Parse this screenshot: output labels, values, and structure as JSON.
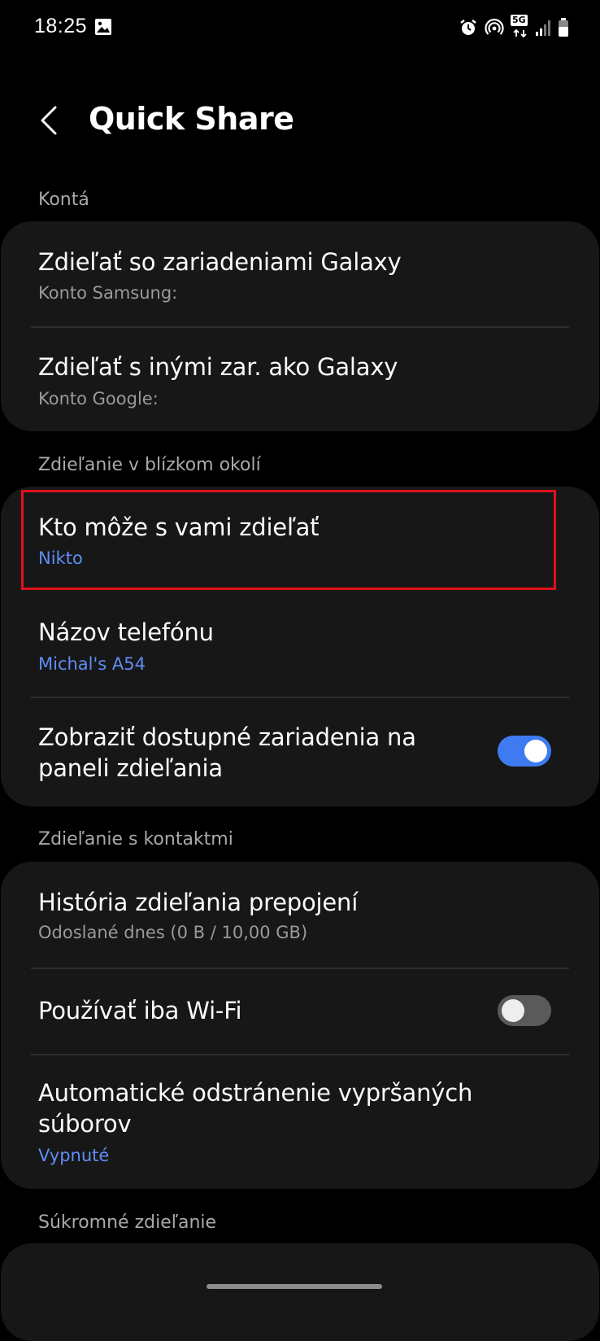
{
  "status_bar": {
    "time": "18:25",
    "left_icons": [
      "gallery-icon"
    ],
    "right_icons": [
      "alarm-icon",
      "hotspot-icon",
      "5g-icon",
      "signal-icon",
      "battery-icon"
    ],
    "network_label": "5G"
  },
  "header": {
    "back_icon": "chevron-left-icon",
    "title": "Quick Share"
  },
  "sections": {
    "accounts": {
      "label": "Kontá",
      "items": [
        {
          "title": "Zdieľať so zariadeniami Galaxy",
          "subtitle": "Konto Samsung:"
        },
        {
          "title": "Zdieľať s inými zar. ako Galaxy",
          "subtitle": "Konto Google:"
        }
      ]
    },
    "nearby": {
      "label": "Zdieľanie v blízkom okolí",
      "items": [
        {
          "title": "Kto môže s vami zdieľať",
          "subtitle": "Nikto"
        },
        {
          "title": "Názov telefónu",
          "subtitle": "Michal's A54"
        },
        {
          "title_line1": "Zobraziť dostupné zariadenia na",
          "title_line2": "paneli zdieľania",
          "toggle_on": true
        }
      ]
    },
    "contacts": {
      "label": "Zdieľanie s kontaktmi",
      "items": [
        {
          "title": "História zdieľania prepojení",
          "subtitle": "Odoslané dnes (0 B / 10,00 GB)"
        },
        {
          "title": "Používať iba Wi-Fi",
          "toggle_on": false
        },
        {
          "title_line1": "Automatické odstránenie vypršaných",
          "title_line2": "súborov",
          "subtitle": "Vypnuté"
        }
      ]
    },
    "private": {
      "label": "Súkromné zdieľanie"
    }
  },
  "colors": {
    "background": "#000000",
    "card": "#171717",
    "accent": "#5d8ef5",
    "toggle_on": "#3e7bf1",
    "highlight": "#e0101a"
  }
}
